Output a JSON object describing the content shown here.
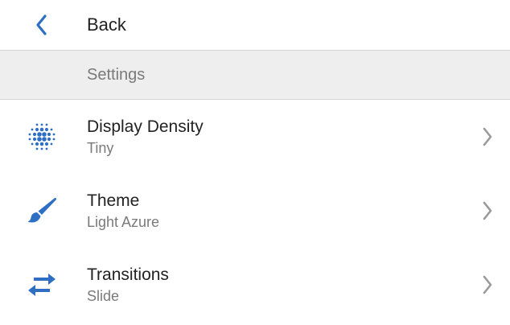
{
  "colors": {
    "accent": "#2e6fc4",
    "text_primary": "#222222",
    "text_secondary": "#7a7a7a",
    "section_bg": "#eeeeee",
    "chevron": "#9a9a9a"
  },
  "nav": {
    "back_label": "Back",
    "back_icon": "chevron-left-icon"
  },
  "section": {
    "title": "Settings"
  },
  "items": [
    {
      "label": "Display Density",
      "value": "Tiny",
      "icon": "density-dots-icon"
    },
    {
      "label": "Theme",
      "value": "Light Azure",
      "icon": "paintbrush-icon"
    },
    {
      "label": "Transitions",
      "value": "Slide",
      "icon": "transition-arrows-icon"
    }
  ]
}
